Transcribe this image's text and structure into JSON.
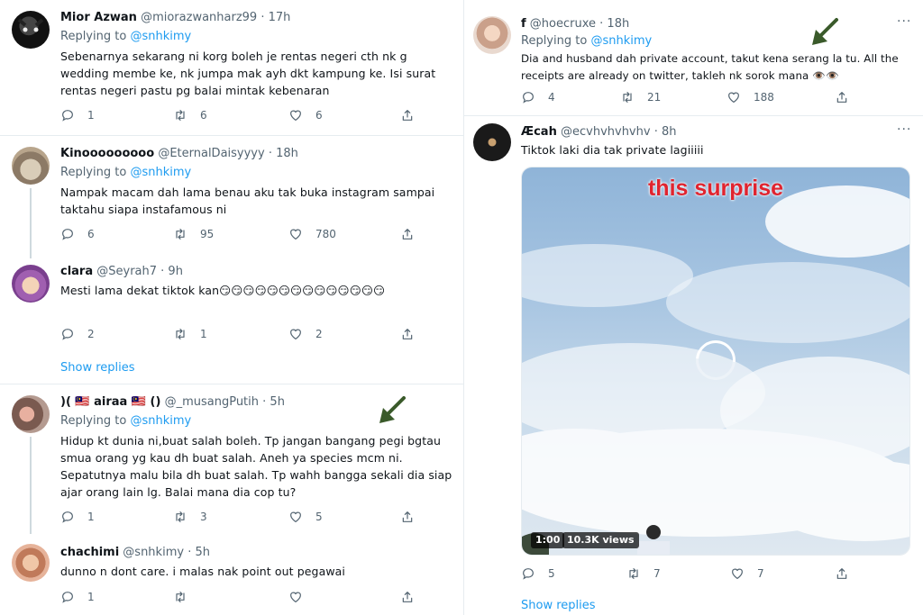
{
  "left_column": {
    "tweets": [
      {
        "name": "Mior Azwan",
        "handle": "@miorazwanharz99",
        "time": "· 17h",
        "replying_label": "Replying to",
        "replying_to": "@snhkimy",
        "text": "Sebenarnya sekarang ni korg boleh je rentas negeri cth nk g\nwedding membe ke, nk jumpa mak ayh dkt kampung ke. Isi surat\nrentas negeri pastu pg balai mintak kebenaran",
        "replies": "1",
        "retweets": "6",
        "likes": "6"
      },
      {
        "name": "Kinooooooooo",
        "handle": "@EternalDaisyyyy",
        "time": "· 18h",
        "replying_label": "Replying to",
        "replying_to": "@snhkimy",
        "text": "Nampak macam dah lama benau aku tak buka instagram sampai\ntaktahu siapa instafamous ni",
        "replies": "6",
        "retweets": "95",
        "likes": "780"
      },
      {
        "name": "clara",
        "handle": "@Seyrah7",
        "time": "· 9h",
        "text": "Mesti lama dekat tiktok kan",
        "emoji": "😏",
        "replies": "2",
        "retweets": "1",
        "likes": "2",
        "show_replies": "Show replies"
      },
      {
        "name": ")( 🇲🇾 airaa 🇲🇾 ()",
        "handle": "@_musangPutih",
        "time": "· 5h",
        "replying_label": "Replying to",
        "replying_to": "@snhkimy",
        "text": "Hidup kt dunia ni,buat salah boleh. Tp jangan bangang pegi bgtau\nsmua orang yg kau dh buat salah. Aneh ya species mcm ni.\nSepatutnya malu bila dh buat salah. Tp wahh bangga sekali dia siap\najar orang lain lg. Balai mana dia cop tu?",
        "replies": "1",
        "retweets": "3",
        "likes": "5"
      },
      {
        "name": "chachimi",
        "handle": "@snhkimy",
        "time": "· 5h",
        "text": "dunno n dont care. i malas nak point out pegawai",
        "replies": "1",
        "retweets": "",
        "likes": ""
      }
    ]
  },
  "right_column": {
    "tweets": [
      {
        "name": "f",
        "handle": "@hoecruxe",
        "time": "· 18h",
        "replying_label": "Replying to",
        "replying_to": "@snhkimy",
        "text": "Dia and husband dah private account, takut kena serang la tu. All the\nreceipts are already on twitter, takleh nk sorok mana 👁️👁️",
        "replies": "4",
        "retweets": "21",
        "likes": "188"
      },
      {
        "name": "Æcah",
        "handle": "@ecvhvhvhvhv",
        "time": "· 8h",
        "text": "Tiktok laki dia tak private lagiiiii",
        "video_caption": "this surprise",
        "video_duration": "1:00",
        "video_views": "10.3K views",
        "replies": "5",
        "retweets": "7",
        "likes": "7",
        "show_replies": "Show replies"
      }
    ],
    "more_menu": "···"
  },
  "colors": {
    "link_blue": "#1d9bf0",
    "text_dark": "#0f1419",
    "text_muted": "#536471",
    "divider": "#e6ecf0",
    "arrow_green": "#3a5a2a",
    "caption_red": "#e0242f"
  },
  "icons": [
    "reply-icon",
    "retweet-icon",
    "like-icon",
    "share-icon",
    "arrow-annotation-icon",
    "loading-spinner-icon"
  ]
}
